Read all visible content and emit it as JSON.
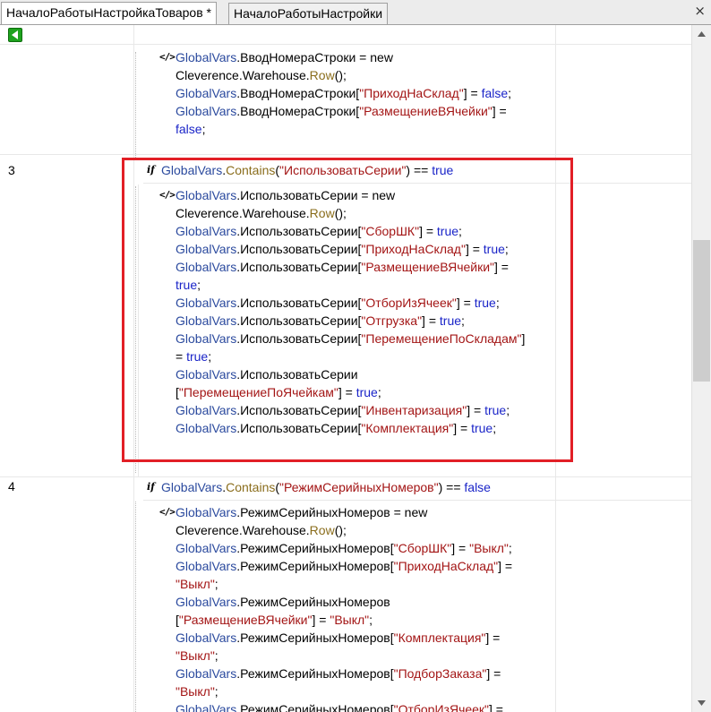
{
  "tabs": [
    {
      "label": "НачалоРаботыНастройкаТоваров *",
      "active": true
    },
    {
      "label": "НачалоРаботыНастройки",
      "active": false
    }
  ],
  "close_label": "×",
  "rows": [
    {
      "number": "",
      "condition": null,
      "lines": [
        [
          [
            "n",
            "GlobalVars"
          ],
          [
            "o",
            "."
          ],
          [
            "o",
            "ВводНомераСтроки = new"
          ]
        ],
        [
          [
            "o",
            "Cleverence.Warehouse."
          ],
          [
            "m",
            "Row"
          ],
          [
            "o",
            "();"
          ]
        ],
        [
          [
            "n",
            "GlobalVars"
          ],
          [
            "o",
            ".ВводНомераСтроки["
          ],
          [
            "s",
            "\"ПриходНаСклад\""
          ],
          [
            "o",
            "] = "
          ],
          [
            "b",
            "false"
          ],
          [
            "o",
            ";"
          ]
        ],
        [
          [
            "n",
            "GlobalVars"
          ],
          [
            "o",
            ".ВводНомераСтроки["
          ],
          [
            "s",
            "\"РазмещениеВЯчейки\""
          ],
          [
            "o",
            "] ="
          ]
        ],
        [
          [
            "b",
            "false"
          ],
          [
            "o",
            ";"
          ]
        ]
      ]
    },
    {
      "number": "3",
      "condition": [
        [
          "n",
          "GlobalVars"
        ],
        [
          "o",
          "."
        ],
        [
          "m",
          "Contains"
        ],
        [
          "o",
          "("
        ],
        [
          "s",
          "\"ИспользоватьСерии\""
        ],
        [
          "o",
          ") == "
        ],
        [
          "b",
          "true"
        ]
      ],
      "lines": [
        [
          [
            "n",
            "GlobalVars"
          ],
          [
            "o",
            ".ИспользоватьСерии = new"
          ]
        ],
        [
          [
            "o",
            "Cleverence.Warehouse."
          ],
          [
            "m",
            "Row"
          ],
          [
            "o",
            "();"
          ]
        ],
        [
          [
            "n",
            "GlobalVars"
          ],
          [
            "o",
            ".ИспользоватьСерии["
          ],
          [
            "s",
            "\"СборШК\""
          ],
          [
            "o",
            "] = "
          ],
          [
            "b",
            "true"
          ],
          [
            "o",
            ";"
          ]
        ],
        [
          [
            "n",
            "GlobalVars"
          ],
          [
            "o",
            ".ИспользоватьСерии["
          ],
          [
            "s",
            "\"ПриходНаСклад\""
          ],
          [
            "o",
            "] = "
          ],
          [
            "b",
            "true"
          ],
          [
            "o",
            ";"
          ]
        ],
        [
          [
            "n",
            "GlobalVars"
          ],
          [
            "o",
            ".ИспользоватьСерии["
          ],
          [
            "s",
            "\"РазмещениеВЯчейки\""
          ],
          [
            "o",
            "] ="
          ]
        ],
        [
          [
            "b",
            "true"
          ],
          [
            "o",
            ";"
          ]
        ],
        [
          [
            "n",
            "GlobalVars"
          ],
          [
            "o",
            ".ИспользоватьСерии["
          ],
          [
            "s",
            "\"ОтборИзЯчеек\""
          ],
          [
            "o",
            "] = "
          ],
          [
            "b",
            "true"
          ],
          [
            "o",
            ";"
          ]
        ],
        [
          [
            "n",
            "GlobalVars"
          ],
          [
            "o",
            ".ИспользоватьСерии["
          ],
          [
            "s",
            "\"Отгрузка\""
          ],
          [
            "o",
            "] = "
          ],
          [
            "b",
            "true"
          ],
          [
            "o",
            ";"
          ]
        ],
        [
          [
            "n",
            "GlobalVars"
          ],
          [
            "o",
            ".ИспользоватьСерии["
          ],
          [
            "s",
            "\"ПеремещениеПоСкладам\""
          ],
          [
            "o",
            "]"
          ]
        ],
        [
          [
            "o",
            "= "
          ],
          [
            "b",
            "true"
          ],
          [
            "o",
            ";"
          ]
        ],
        [
          [
            "n",
            "GlobalVars"
          ],
          [
            "o",
            ".ИспользоватьСерии"
          ]
        ],
        [
          [
            "o",
            "["
          ],
          [
            "s",
            "\"ПеремещениеПоЯчейкам\""
          ],
          [
            "o",
            "] = "
          ],
          [
            "b",
            "true"
          ],
          [
            "o",
            ";"
          ]
        ],
        [
          [
            "n",
            "GlobalVars"
          ],
          [
            "o",
            ".ИспользоватьСерии["
          ],
          [
            "s",
            "\"Инвентаризация\""
          ],
          [
            "o",
            "] = "
          ],
          [
            "b",
            "true"
          ],
          [
            "o",
            ";"
          ]
        ],
        [
          [
            "n",
            "GlobalVars"
          ],
          [
            "o",
            ".ИспользоватьСерии["
          ],
          [
            "s",
            "\"Комплектация\""
          ],
          [
            "o",
            "] = "
          ],
          [
            "b",
            "true"
          ],
          [
            "o",
            ";"
          ]
        ]
      ]
    },
    {
      "number": "4",
      "condition": [
        [
          "n",
          "GlobalVars"
        ],
        [
          "o",
          "."
        ],
        [
          "m",
          "Contains"
        ],
        [
          "o",
          "("
        ],
        [
          "s",
          "\"РежимСерийныхНомеров\""
        ],
        [
          "o",
          ") == "
        ],
        [
          "b",
          "false"
        ]
      ],
      "lines": [
        [
          [
            "n",
            "GlobalVars"
          ],
          [
            "o",
            ".РежимСерийныхНомеров = new"
          ]
        ],
        [
          [
            "o",
            "Cleverence.Warehouse."
          ],
          [
            "m",
            "Row"
          ],
          [
            "o",
            "();"
          ]
        ],
        [
          [
            "n",
            "GlobalVars"
          ],
          [
            "o",
            ".РежимСерийныхНомеров["
          ],
          [
            "s",
            "\"СборШК\""
          ],
          [
            "o",
            "] = "
          ],
          [
            "s",
            "\"Выкл\""
          ],
          [
            "o",
            ";"
          ]
        ],
        [
          [
            "n",
            "GlobalVars"
          ],
          [
            "o",
            ".РежимСерийныхНомеров["
          ],
          [
            "s",
            "\"ПриходНаСклад\""
          ],
          [
            "o",
            "] ="
          ]
        ],
        [
          [
            "s",
            "\"Выкл\""
          ],
          [
            "o",
            ";"
          ]
        ],
        [
          [
            "n",
            "GlobalVars"
          ],
          [
            "o",
            ".РежимСерийныхНомеров"
          ]
        ],
        [
          [
            "o",
            "["
          ],
          [
            "s",
            "\"РазмещениеВЯчейки\""
          ],
          [
            "o",
            "] = "
          ],
          [
            "s",
            "\"Выкл\""
          ],
          [
            "o",
            ";"
          ]
        ],
        [
          [
            "n",
            "GlobalVars"
          ],
          [
            "o",
            ".РежимСерийныхНомеров["
          ],
          [
            "s",
            "\"Комплектация\""
          ],
          [
            "o",
            "] ="
          ]
        ],
        [
          [
            "s",
            "\"Выкл\""
          ],
          [
            "o",
            ";"
          ]
        ],
        [
          [
            "n",
            "GlobalVars"
          ],
          [
            "o",
            ".РежимСерийныхНомеров["
          ],
          [
            "s",
            "\"ПодборЗаказа\""
          ],
          [
            "o",
            "] ="
          ]
        ],
        [
          [
            "s",
            "\"Выкл\""
          ],
          [
            "o",
            ";"
          ]
        ],
        [
          [
            "n",
            "GlobalVars"
          ],
          [
            "o",
            ".РежимСерийныхНомеров["
          ],
          [
            "s",
            "\"ОтборИзЯчеек\""
          ],
          [
            "o",
            "] ="
          ]
        ]
      ]
    }
  ],
  "colors": {
    "identifier": "#2b4a9e",
    "method": "#8a6d1c",
    "string": "#a31515",
    "keyword": "#1a24c8",
    "highlight": "#e21f26"
  },
  "icons": {
    "back": "back-arrow-icon",
    "if": "if-icon",
    "code": "code-icon"
  }
}
